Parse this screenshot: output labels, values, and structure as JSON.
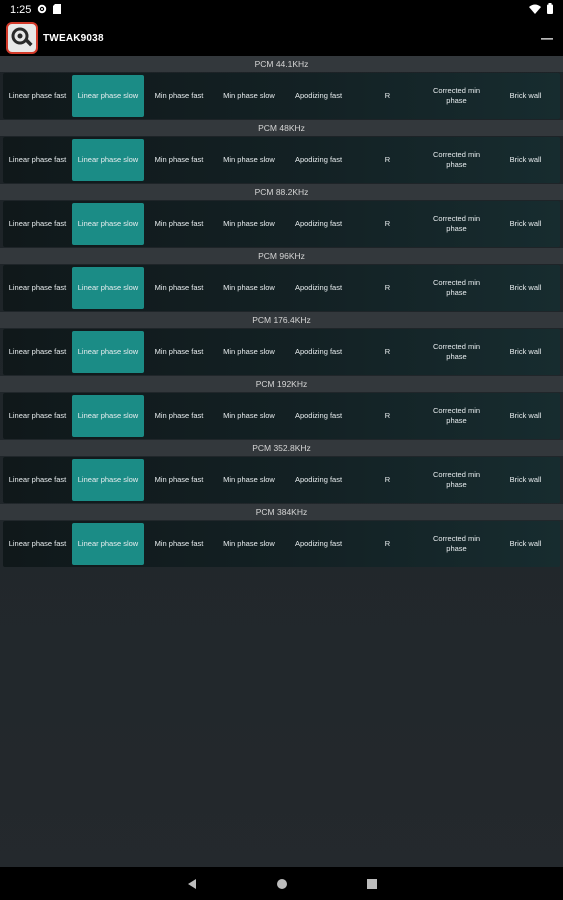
{
  "status": {
    "time": "1:25",
    "icons": [
      "settings-gear-icon",
      "sd-card-icon",
      "wifi-icon",
      "battery-icon"
    ]
  },
  "app": {
    "title": "TWEAK9038",
    "overflow_label": "—",
    "logo_icon": "gear-magnifier-icon",
    "accent": "#1b8c86",
    "logo_border": "#d23a2a"
  },
  "filter_options": [
    "Linear phase fast",
    "Linear phase slow",
    "Min phase fast",
    "Min phase slow",
    "Apodizing fast",
    "R",
    "Corrected min phase",
    "Brick wall"
  ],
  "sections": [
    {
      "title": "PCM 44.1KHz",
      "selected_index": 1
    },
    {
      "title": "PCM 48KHz",
      "selected_index": 1
    },
    {
      "title": "PCM 88.2KHz",
      "selected_index": 1
    },
    {
      "title": "PCM 96KHz",
      "selected_index": 1
    },
    {
      "title": "PCM 176.4KHz",
      "selected_index": 1
    },
    {
      "title": "PCM 192KHz",
      "selected_index": 1
    },
    {
      "title": "PCM 352.8KHz",
      "selected_index": 1
    },
    {
      "title": "PCM 384KHz",
      "selected_index": 1
    }
  ],
  "nav": {
    "back": "back-triangle-icon",
    "home": "home-circle-icon",
    "recents": "recents-square-icon"
  }
}
